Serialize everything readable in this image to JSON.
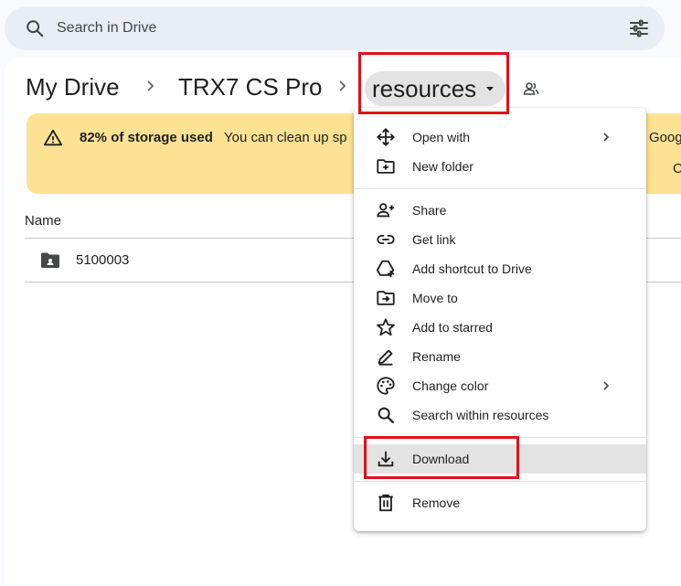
{
  "search": {
    "placeholder": "Search in Drive"
  },
  "breadcrumb": {
    "root": "My Drive",
    "parent": "TRX7 CS Pro",
    "current": "resources"
  },
  "banner": {
    "bold": "82% of storage used",
    "rest": "You can clean up sp",
    "right_top": "Goog",
    "right_bottom": "C"
  },
  "list": {
    "header": "Name",
    "rows": [
      {
        "name": "5100003"
      }
    ]
  },
  "menu": {
    "open_with": "Open with",
    "new_folder": "New folder",
    "share": "Share",
    "get_link": "Get link",
    "add_shortcut": "Add shortcut to Drive",
    "move_to": "Move to",
    "add_starred": "Add to starred",
    "rename": "Rename",
    "change_color": "Change color",
    "search_within": "Search within resources",
    "download": "Download",
    "remove": "Remove"
  },
  "colors": {
    "highlight": "#e0101a",
    "banner": "#fde293"
  }
}
